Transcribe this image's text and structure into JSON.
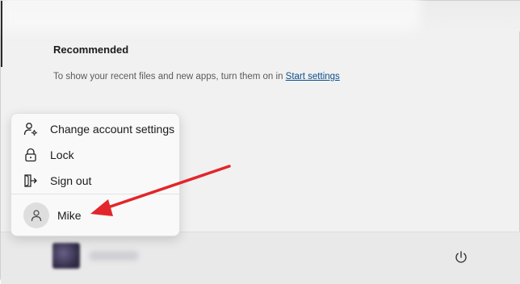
{
  "recommended": {
    "title": "Recommended",
    "text": "To show your recent files and new apps, turn them on in ",
    "link": "Start settings"
  },
  "account_menu": {
    "items": [
      {
        "label": "Change account settings",
        "icon": "person-gear-icon"
      },
      {
        "label": "Lock",
        "icon": "lock-icon"
      },
      {
        "label": "Sign out",
        "icon": "sign-out-icon"
      }
    ],
    "account": {
      "name": "Mike",
      "icon": "person-icon"
    }
  },
  "footer": {
    "power_icon": "power-icon"
  },
  "annotation": {
    "arrow_color": "#e2262b"
  }
}
